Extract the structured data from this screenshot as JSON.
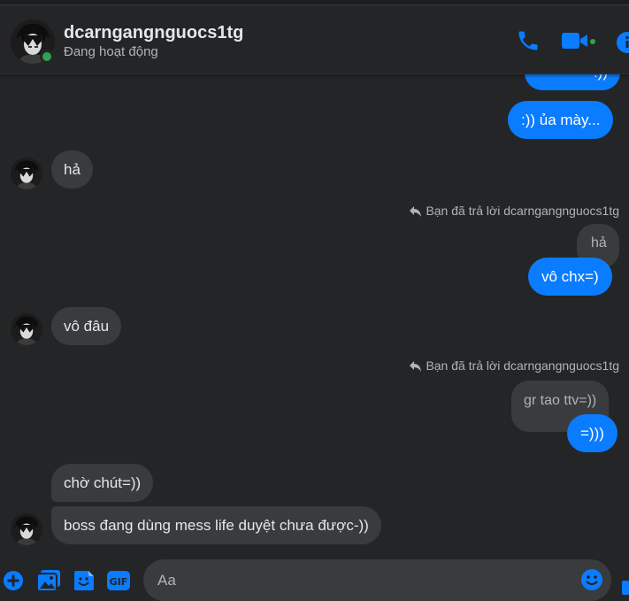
{
  "header": {
    "contact_name": "dcarngangnguocs1tg",
    "status": "Đang hoạt động",
    "accent_color": "#0a7cff",
    "online_color": "#31a24c"
  },
  "messages": {
    "m0": {
      "text": ":))",
      "direction": "outgoing",
      "partially_visible": true
    },
    "m1": {
      "text": ":)) ủa mày...",
      "direction": "outgoing"
    },
    "m2": {
      "text": "hả",
      "direction": "incoming"
    },
    "reply_note_1": "Bạn đã trả lời dcarngangnguocs1tg",
    "m3_quote": "hả",
    "m3": {
      "text": "vô chx=)",
      "direction": "outgoing"
    },
    "m4": {
      "text": "vô đâu",
      "direction": "incoming"
    },
    "reply_note_2": "Bạn đã trả lời dcarngangnguocs1tg",
    "m5_quote": "gr tao ttv=))",
    "m5": {
      "text": "=)))",
      "direction": "outgoing"
    },
    "m6": {
      "text": "chờ chút=))",
      "direction": "incoming"
    },
    "m7": {
      "text": "boss đang dùng mess life duyệt chưa được-))",
      "direction": "incoming"
    }
  },
  "composer": {
    "placeholder": "Aa",
    "value": "",
    "icons": [
      "plus-circle-icon",
      "photo-icon",
      "sticker-icon",
      "gif-icon",
      "emoji-icon"
    ]
  }
}
